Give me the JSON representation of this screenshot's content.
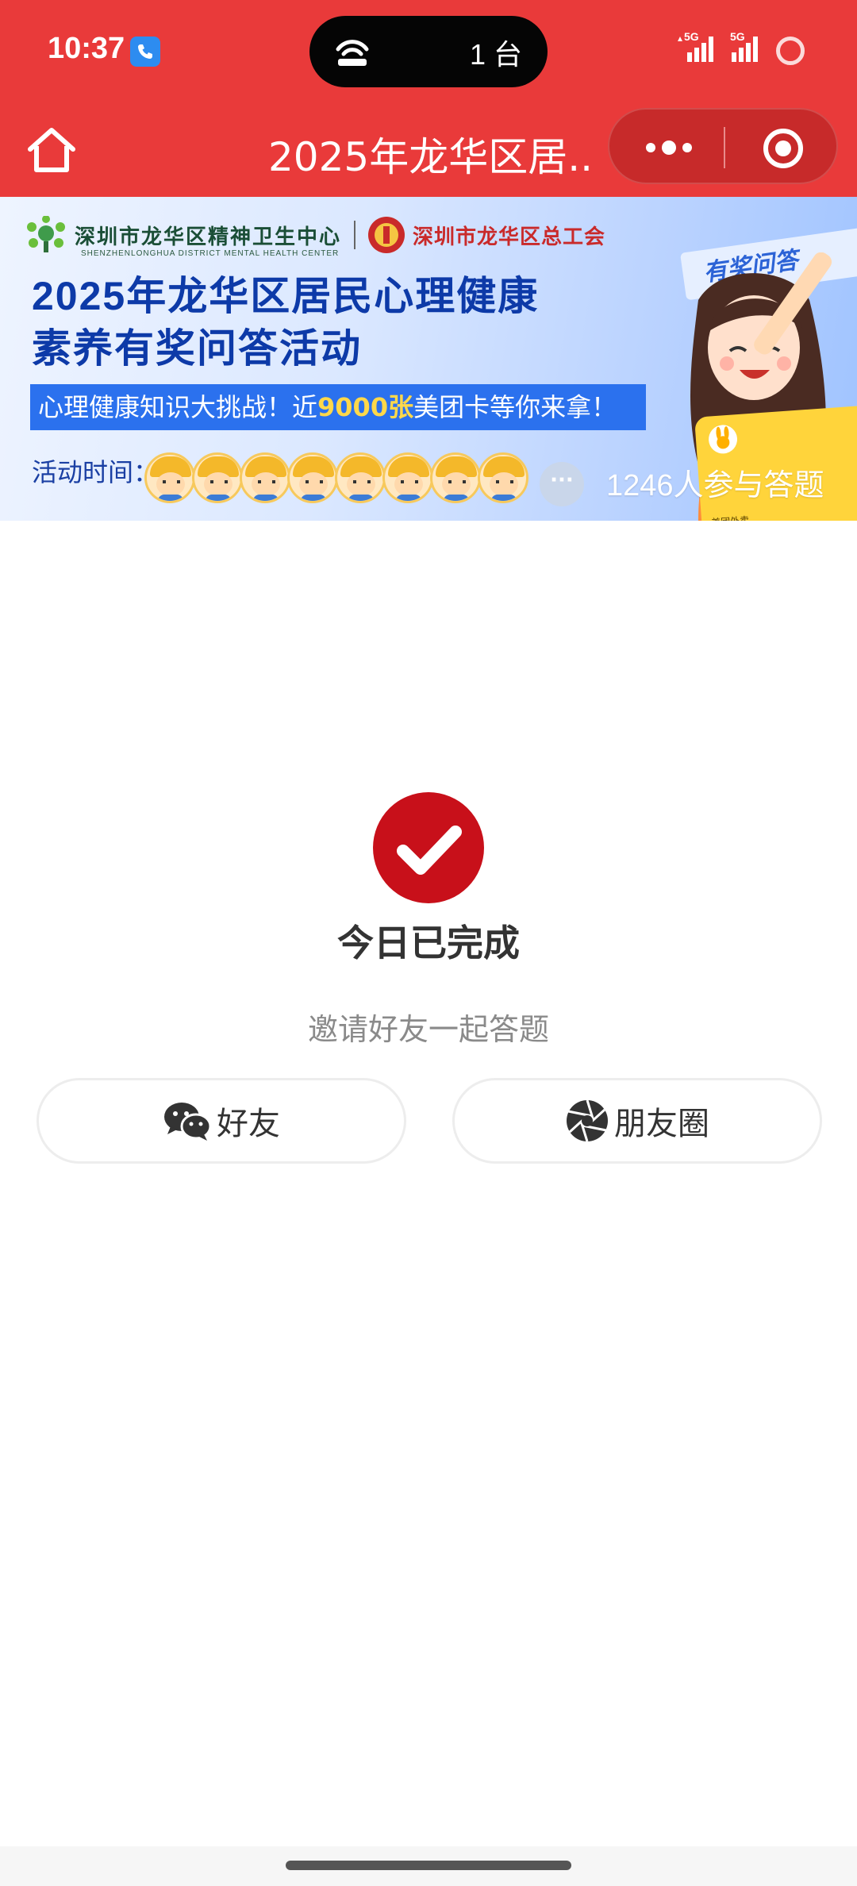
{
  "status_bar": {
    "time": "10:37",
    "cast_count": "1 台",
    "signal_1_label": "5G",
    "signal_2_label": "5G"
  },
  "navbar": {
    "title": "2025年龙华区居...",
    "icons": [
      "home-icon",
      "more-icon",
      "close-miniprogram-icon"
    ]
  },
  "banner": {
    "org1_name": "深圳市龙华区精神卫生中心",
    "org1_english": "SHENZHENLONGHUA DISTRICT MENTAL HEALTH CENTER",
    "org2_name": "深圳市龙华区总工会",
    "title_line1": "2025年龙华区居民心理健康",
    "title_line2": "素养有奖问答活动",
    "strip_prefix": "心理健康知识大挑战！近",
    "strip_highlight": "9000张",
    "strip_suffix": "美团卡等你来拿！",
    "activity_time_label": "活动时间：",
    "prize_tag": "有奖问答",
    "card_brand": "美团外卖",
    "participants_count_text": "1246人参与答题",
    "avatar_count": 8,
    "more_avatars_symbol": "···"
  },
  "completion": {
    "title": "今日已完成",
    "invite_text": "邀请好友一起答题",
    "friends_button": "好友",
    "moments_button": "朋友圈"
  },
  "colors": {
    "header_red": "#e93a3a",
    "capsule_red": "#c72a2a",
    "check_red": "#c8101a",
    "banner_blue": "#0d3aa8",
    "strip_blue": "#2b71ee",
    "highlight_yellow": "#ffd84a"
  }
}
